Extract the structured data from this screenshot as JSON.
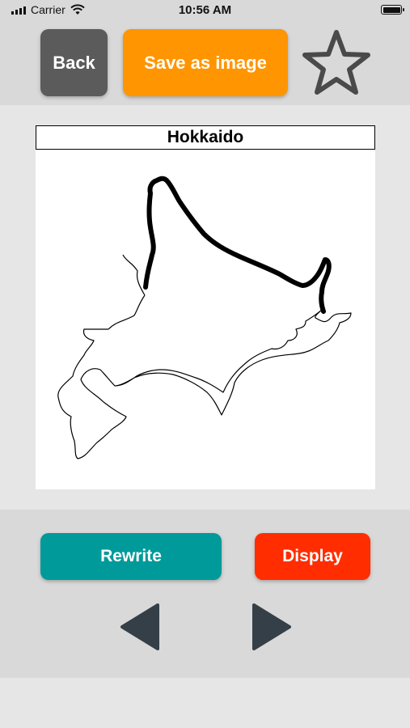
{
  "status_bar": {
    "carrier": "Carrier",
    "time": "10:56 AM"
  },
  "toolbar": {
    "back_label": "Back",
    "save_label": "Save as image"
  },
  "map": {
    "title": "Hokkaido"
  },
  "actions": {
    "rewrite_label": "Rewrite",
    "display_label": "Display"
  },
  "colors": {
    "back": "#5b5b5b",
    "save": "#ff9500",
    "rewrite": "#009a9a",
    "display": "#ff2d00",
    "nav_arrow": "#353f47"
  },
  "icons": {
    "favorite": "star-outline-icon",
    "prev": "triangle-left-icon",
    "next": "triangle-right-icon",
    "wifi": "wifi-icon",
    "battery": "battery-icon"
  }
}
